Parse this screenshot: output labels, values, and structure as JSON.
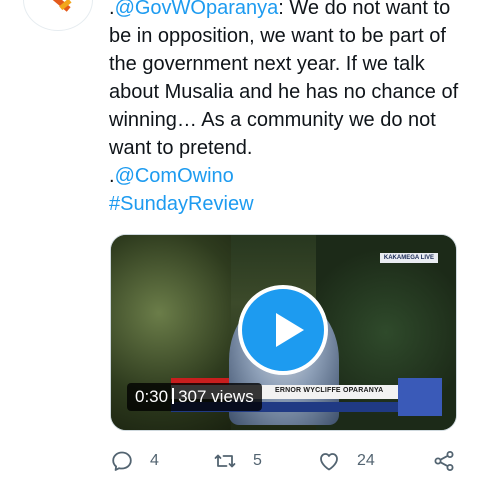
{
  "tweet": {
    "line1_prefix": ".",
    "mention1": "@GovWOparanya",
    "line1_text": ": We do not want to be in opposition, we want to be part of the government next year. If we talk about Musalia and he has no chance of winning… As a community we do not want to pretend.",
    "line2_prefix": ".",
    "mention2": "@ComOwino",
    "hashtag": "#SundayReview"
  },
  "media": {
    "duration": "0:30",
    "views": "307 views",
    "channel_tag": "KAKAMEGA LIVE",
    "lower_third": "ERNOR WYCLIFFE OPARANYA"
  },
  "actions": {
    "reply_count": "4",
    "retweet_count": "5",
    "like_count": "24"
  },
  "colors": {
    "link": "#1d9bf0",
    "play_button": "#1d9bf0",
    "action_gray": "#536471"
  },
  "icons": [
    "reply-icon",
    "retweet-icon",
    "like-icon",
    "share-icon",
    "play-icon"
  ]
}
